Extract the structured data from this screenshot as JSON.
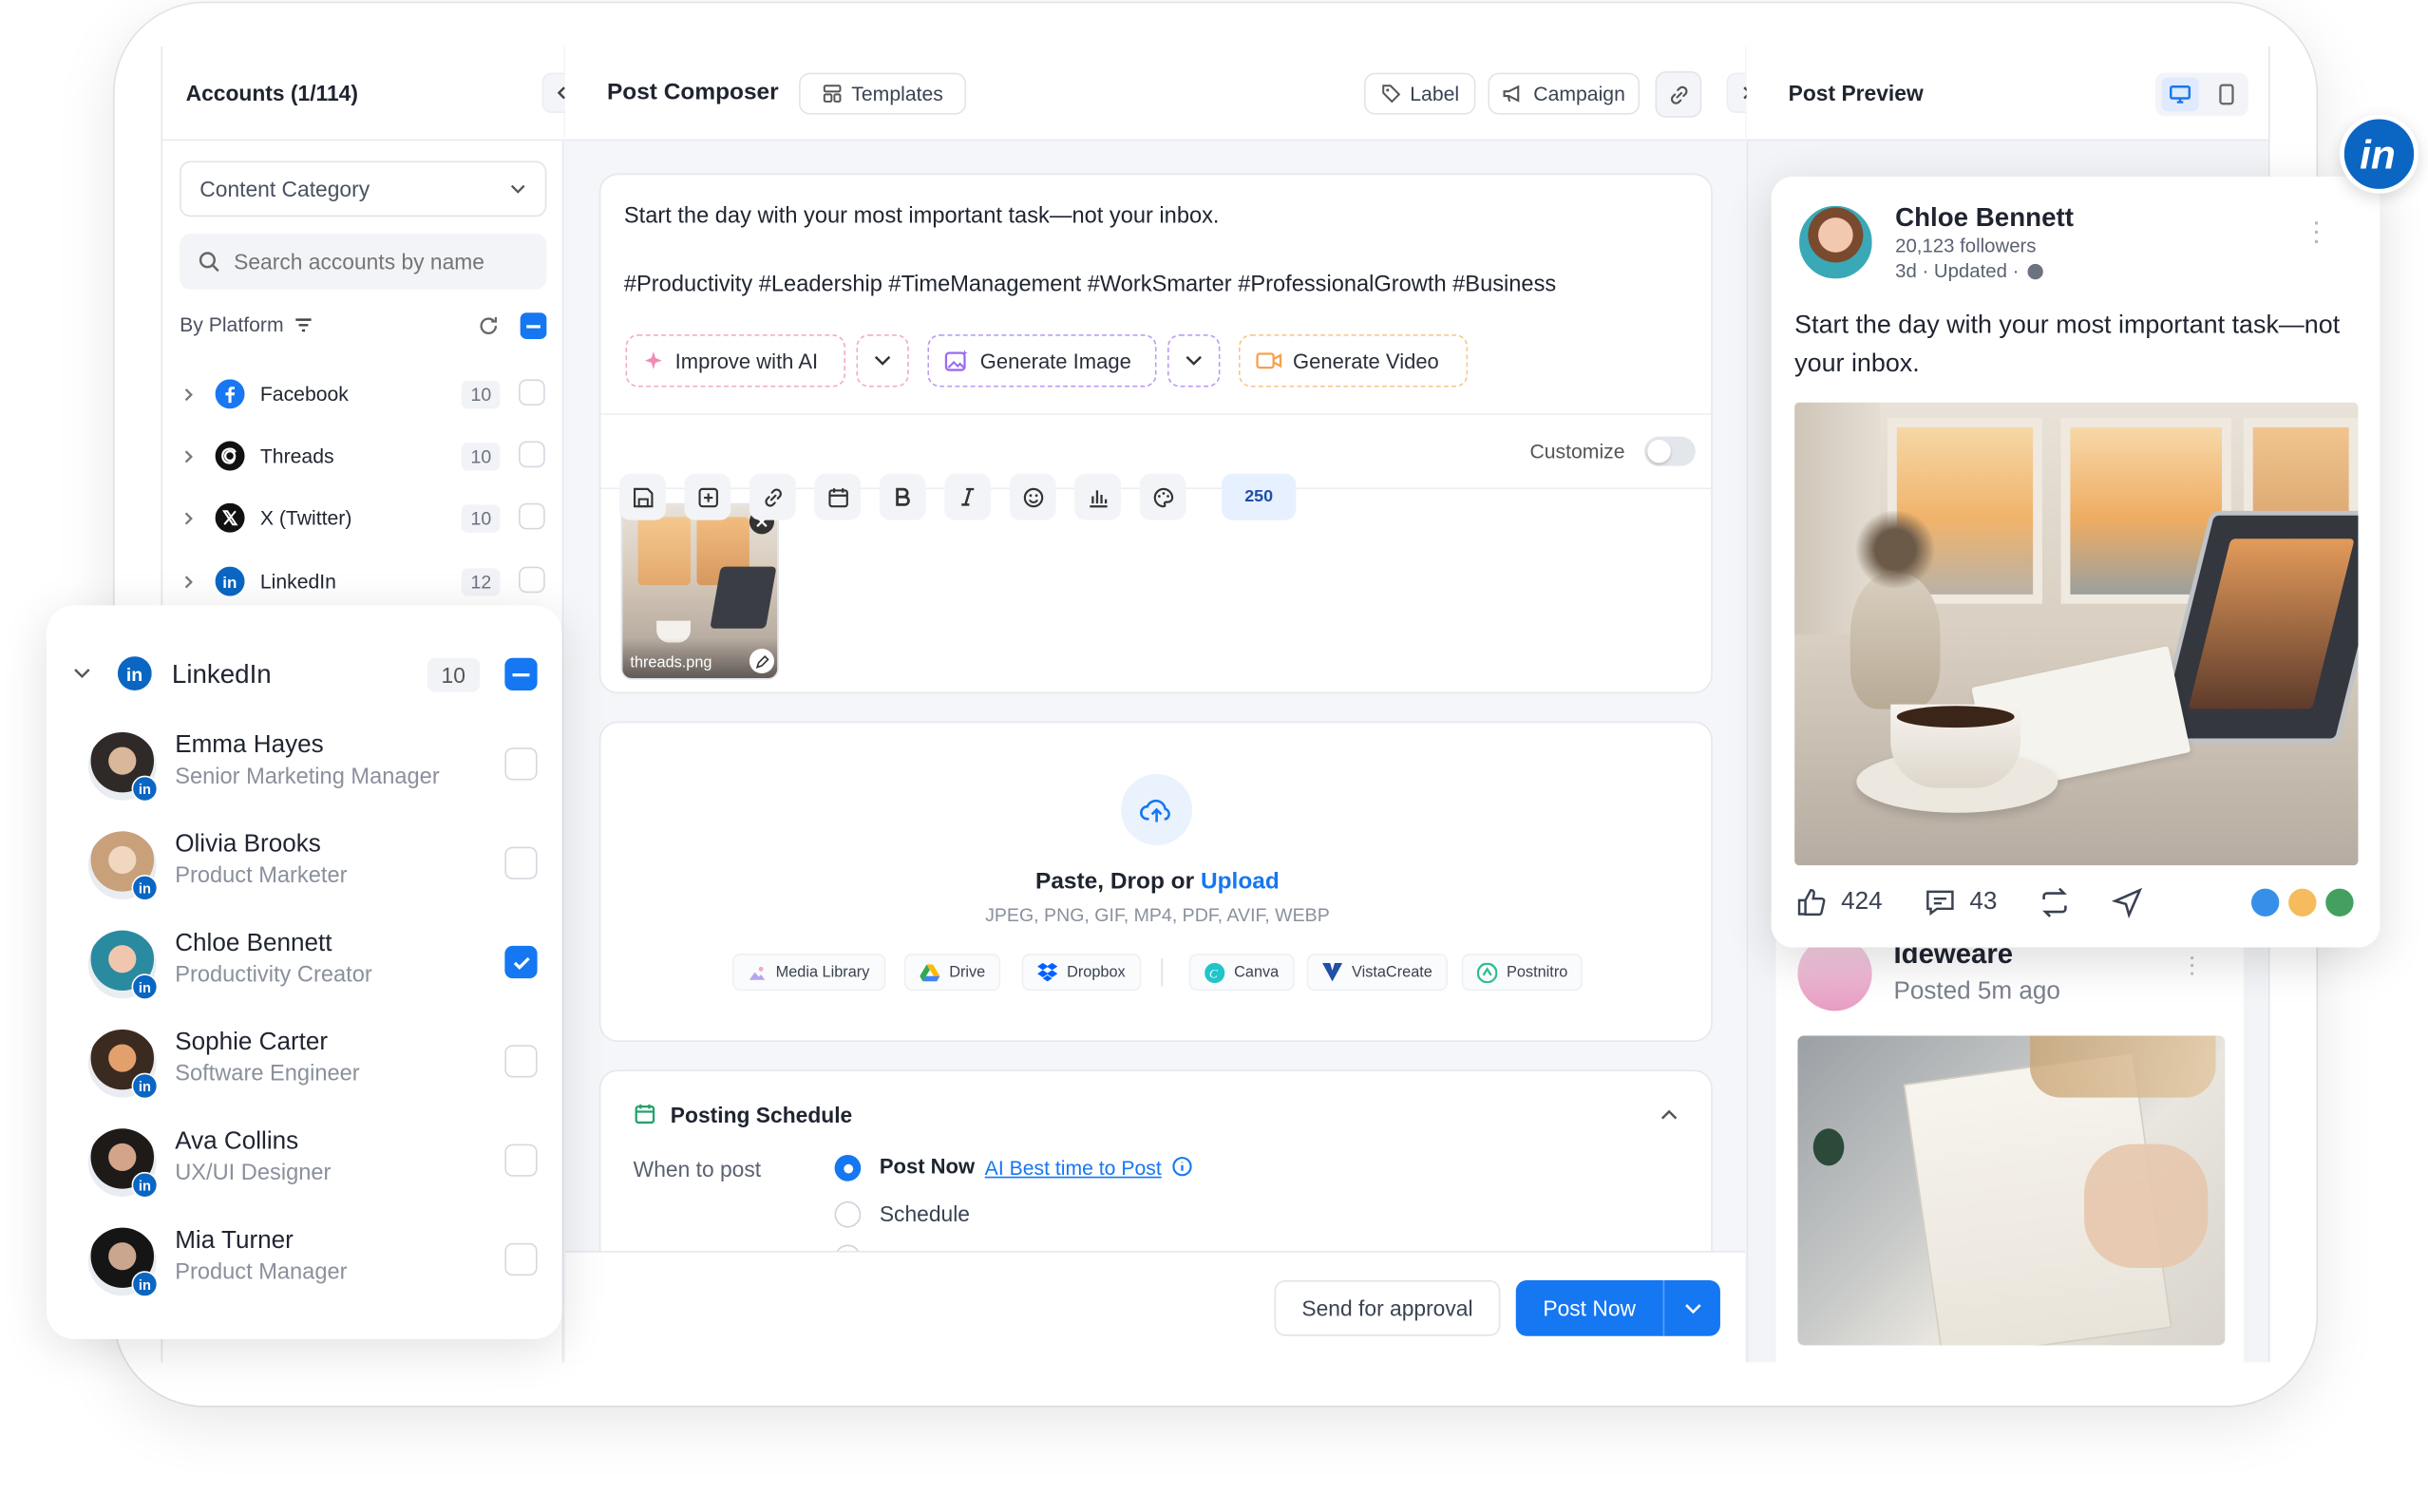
{
  "header": {
    "accounts_title": "Accounts (1/114)",
    "composer_title": "Post Composer",
    "templates": "Templates",
    "label": "Label",
    "campaign": "Campaign",
    "preview_title": "Post Preview"
  },
  "sidebar": {
    "category_placeholder": "Content Category",
    "search_placeholder": "Search accounts by name",
    "by_platform": "By Platform",
    "platforms": [
      {
        "name": "Facebook",
        "count": "10"
      },
      {
        "name": "Threads",
        "count": "10"
      },
      {
        "name": "X (Twitter)",
        "count": "10"
      },
      {
        "name": "LinkedIn",
        "count": "12"
      }
    ]
  },
  "linkedin_panel": {
    "title": "LinkedIn",
    "count": "10",
    "accounts": [
      {
        "name": "Emma Hayes",
        "role": "Senior Marketing Manager",
        "checked": false
      },
      {
        "name": "Olivia Brooks",
        "role": "Product Marketer",
        "checked": false
      },
      {
        "name": "Chloe Bennett",
        "role": "Productivity Creator",
        "checked": true
      },
      {
        "name": "Sophie Carter",
        "role": "Software Engineer",
        "checked": false
      },
      {
        "name": "Ava Collins",
        "role": "UX/UI Designer",
        "checked": false
      },
      {
        "name": "Mia Turner",
        "role": "Product Manager",
        "checked": false
      }
    ]
  },
  "composer": {
    "line1": "Start the day with your most important task—not your inbox.",
    "hashtags": "#Productivity #Leadership #TimeManagement #WorkSmarter #ProfessionalGrowth #Business",
    "improve_ai": "Improve with AI",
    "generate_image": "Generate Image",
    "generate_video": "Generate Video",
    "char_count": "250",
    "customize": "Customize",
    "attachment_name": "threads.png"
  },
  "upload": {
    "heading_prefix": "Paste, Drop or ",
    "heading_link": "Upload",
    "formats": "JPEG, PNG, GIF, MP4, PDF, AVIF, WEBP",
    "sources": [
      "Media Library",
      "Drive",
      "Dropbox",
      "Canva",
      "VistaCreate",
      "Postnitro"
    ]
  },
  "schedule": {
    "title": "Posting Schedule",
    "when_label": "When to post",
    "post_now": "Post Now",
    "ai_best_time": "AI Best time to Post",
    "schedule": "Schedule"
  },
  "footer": {
    "send_approval": "Send for approval",
    "post_now": "Post Now"
  },
  "preview": {
    "name": "Chloe Bennett",
    "followers": "20,123 followers",
    "meta": "3d · Updated ·",
    "text": "Start the day with your most important task—not your inbox.",
    "likes": "424",
    "comments": "43",
    "second": {
      "name": "Ideweare",
      "meta": "Posted 5m ago"
    }
  },
  "colors": {
    "primary": "#1577f2",
    "linkedin": "#0a66c2",
    "ai_pink": "#f08bb5",
    "ai_purple": "#9b6bf0",
    "video_orange": "#f5a14b"
  }
}
